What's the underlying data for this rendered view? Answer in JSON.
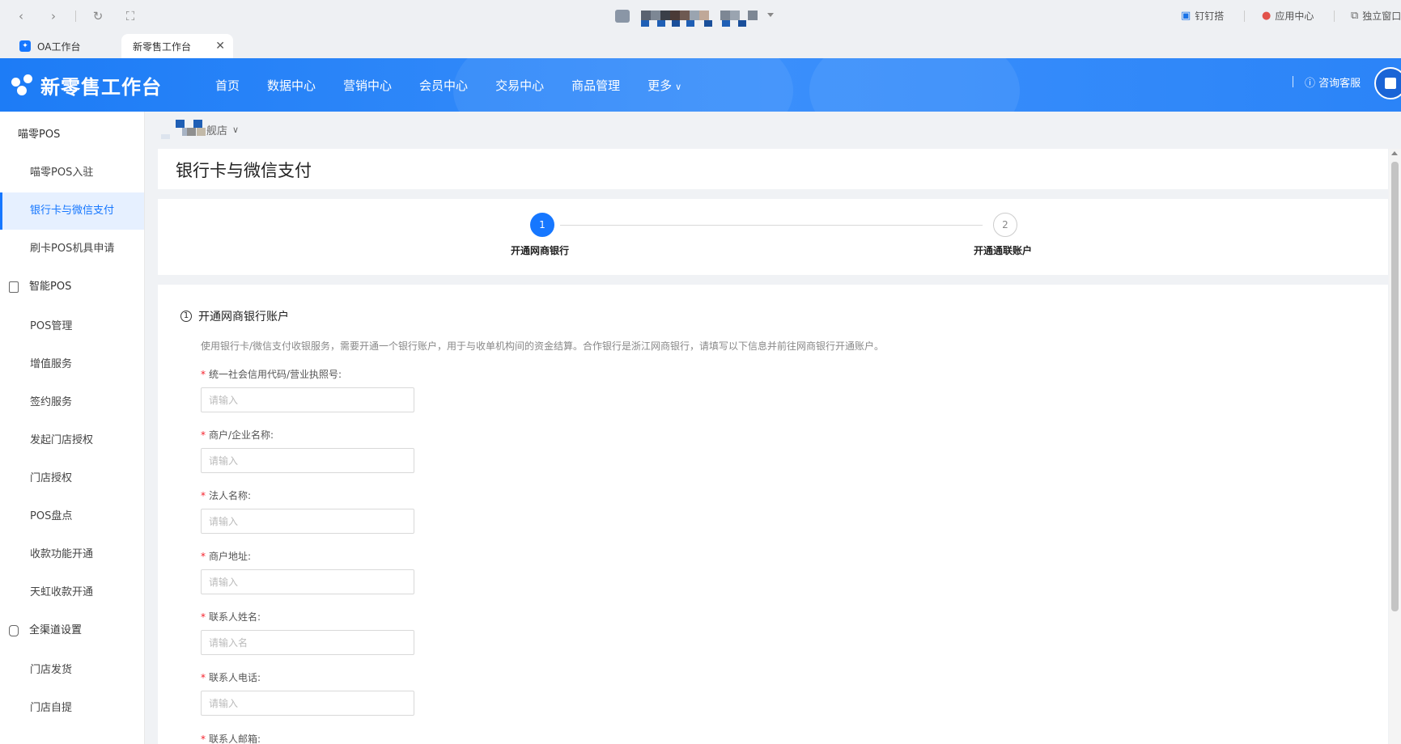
{
  "browser": {
    "tabs": [
      {
        "label": "OA工作台"
      },
      {
        "label": "新零售工作台"
      }
    ],
    "right_items": [
      {
        "label": "钉钉搭"
      },
      {
        "label": "应用中心"
      },
      {
        "label": "独立窗口"
      }
    ]
  },
  "header": {
    "logo_text": "新零售工作台",
    "nav": [
      {
        "label": "首页"
      },
      {
        "label": "数据中心"
      },
      {
        "label": "营销中心"
      },
      {
        "label": "会员中心"
      },
      {
        "label": "交易中心"
      },
      {
        "label": "商品管理"
      },
      {
        "label": "更多"
      }
    ],
    "service_label": "咨询客服"
  },
  "sidebar": {
    "items": [
      {
        "label": "喵零POS"
      },
      {
        "label": "喵零POS入驻"
      },
      {
        "label": "银行卡与微信支付"
      },
      {
        "label": "刷卡POS机具申请"
      },
      {
        "label": "智能POS"
      },
      {
        "label": "POS管理"
      },
      {
        "label": "增值服务"
      },
      {
        "label": "签约服务"
      },
      {
        "label": "发起门店授权"
      },
      {
        "label": "门店授权"
      },
      {
        "label": "POS盘点"
      },
      {
        "label": "收款功能开通"
      },
      {
        "label": "天虹收款开通"
      },
      {
        "label": "全渠道设置"
      },
      {
        "label": "门店发货"
      },
      {
        "label": "门店自提"
      }
    ]
  },
  "store": {
    "suffix": "舰店"
  },
  "page": {
    "title": "银行卡与微信支付",
    "steps": [
      {
        "number": "1",
        "label": "开通网商银行"
      },
      {
        "number": "2",
        "label": "开通通联账户"
      }
    ],
    "section": {
      "number": "1",
      "title": "开通网商银行账户",
      "description": "使用银行卡/微信支付收银服务，需要开通一个银行账户，用于与收单机构间的资金结算。合作银行是浙江网商银行，请填写以下信息并前往网商银行开通账户。"
    },
    "fields": [
      {
        "label": "统一社会信用代码/营业执照号:",
        "placeholder": "请输入"
      },
      {
        "label": "商户/企业名称:",
        "placeholder": "请输入"
      },
      {
        "label": "法人名称:",
        "placeholder": "请输入"
      },
      {
        "label": "商户地址:",
        "placeholder": "请输入"
      },
      {
        "label": "联系人姓名:",
        "placeholder": "请输入名"
      },
      {
        "label": "联系人电话:",
        "placeholder": "请输入"
      },
      {
        "label": "联系人邮箱:",
        "placeholder": ""
      }
    ]
  },
  "colors": {
    "brand": "#1677ff",
    "header_start": "#1d7cf6",
    "required": "#f5222d"
  }
}
